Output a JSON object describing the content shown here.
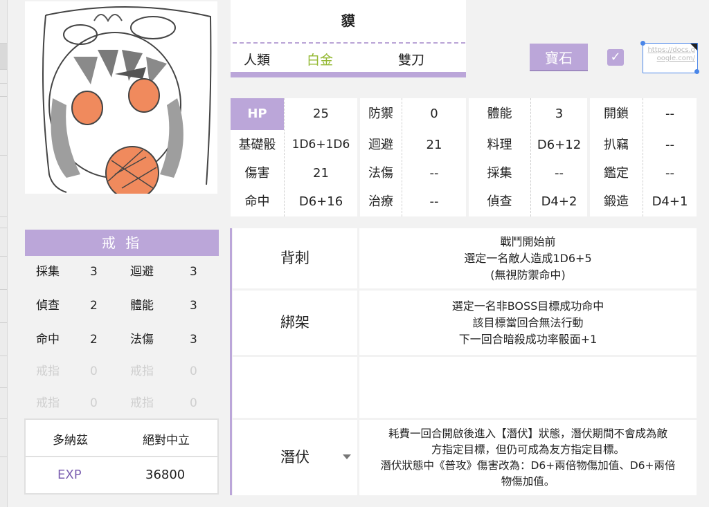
{
  "header": {
    "name": "貘",
    "race": "人類",
    "rank": "白金",
    "weapon": "雙刀",
    "gem_button": "寶石",
    "link_text": "https://docs.google.com/"
  },
  "stats": [
    [
      {
        "label": "HP",
        "value": "25"
      },
      {
        "label": "防禦",
        "value": "0"
      },
      {
        "label": "體能",
        "value": "3"
      },
      {
        "label": "開鎖",
        "value": "--"
      }
    ],
    [
      {
        "label": "基礎骰",
        "value": "1D6+1D6"
      },
      {
        "label": "迴避",
        "value": "21"
      },
      {
        "label": "料理",
        "value": "D6+12"
      },
      {
        "label": "扒竊",
        "value": "--"
      }
    ],
    [
      {
        "label": "傷害",
        "value": "21"
      },
      {
        "label": "法傷",
        "value": "--"
      },
      {
        "label": "採集",
        "value": "--"
      },
      {
        "label": "鑑定",
        "value": "--"
      }
    ],
    [
      {
        "label": "命中",
        "value": "D6+16"
      },
      {
        "label": "治療",
        "value": "--"
      },
      {
        "label": "偵查",
        "value": "D4+2"
      },
      {
        "label": "鍛造",
        "value": "D4+1"
      }
    ]
  ],
  "ring": {
    "title": "戒 指",
    "rows": [
      [
        {
          "label": "採集",
          "value": "3"
        },
        {
          "label": "迴避",
          "value": "3"
        }
      ],
      [
        {
          "label": "偵查",
          "value": "2"
        },
        {
          "label": "體能",
          "value": "3"
        }
      ],
      [
        {
          "label": "命中",
          "value": "2"
        },
        {
          "label": "法傷",
          "value": "3"
        }
      ],
      [
        {
          "label": "戒指",
          "value": "0"
        },
        {
          "label": "戒指",
          "value": "0"
        }
      ],
      [
        {
          "label": "戒指",
          "value": "0"
        },
        {
          "label": "戒指",
          "value": "0"
        }
      ]
    ]
  },
  "info": {
    "deity": "多納茲",
    "alignment": "絕對中立",
    "exp_label": "EXP",
    "exp_value": "36800"
  },
  "skills": [
    {
      "name": "背刺",
      "lines": [
        "戰鬥開始前",
        "選定一名敵人造成1D6+5",
        "(無視防禦命中)"
      ]
    },
    {
      "name": "綁架",
      "lines": [
        "選定一名非BOSS目標成功命中",
        "該目標當回合無法行動",
        "下一回合暗殺成功率骰面+1"
      ]
    },
    {
      "name": "",
      "lines": []
    },
    {
      "name": "潛伏",
      "lines": [
        "耗費一回合開啟後進入【潛伏】狀態，潛伏期間不會成為敵",
        "方指定目標，但仍可成為友方指定目標。",
        "潛伏狀態中《普攻》傷害改為：D6+兩倍物傷加值、D6+兩倍",
        "物傷加值。"
      ]
    }
  ],
  "colors": {
    "accent": "#bba6d9",
    "rank": "#93b832",
    "link": "#4a86e8"
  }
}
